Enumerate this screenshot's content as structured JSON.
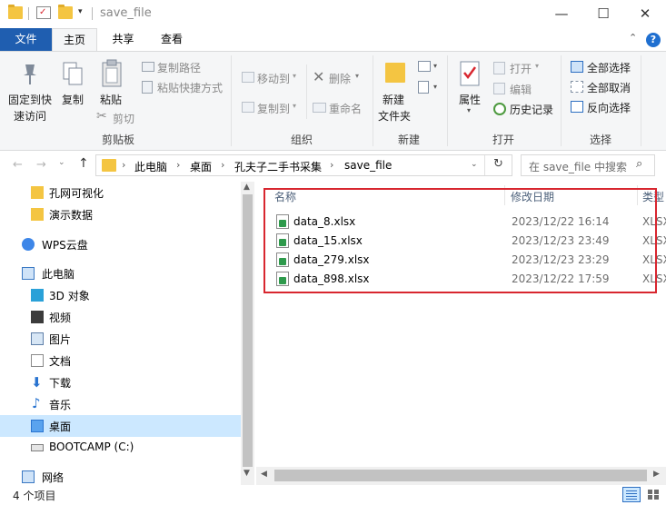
{
  "window": {
    "title": "save_file",
    "minimize": "—",
    "maximize": "☐",
    "close": "✕"
  },
  "tabs": {
    "file": "文件",
    "home": "主页",
    "share": "共享",
    "view": "查看"
  },
  "ribbon": {
    "clipboard": {
      "group": "剪贴板",
      "pin": "固定到快\n速访问",
      "pin_line1": "固定到快",
      "pin_line2": "速访问",
      "copy": "复制",
      "paste": "粘贴",
      "copy_path": "复制路径",
      "paste_shortcut": "粘贴快捷方式",
      "cut": "剪切"
    },
    "organize": {
      "group": "组织",
      "move_to": "移动到",
      "copy_to": "复制到",
      "delete": "删除",
      "rename": "重命名"
    },
    "new": {
      "group": "新建",
      "new_folder_line1": "新建",
      "new_folder_line2": "文件夹"
    },
    "open": {
      "group": "打开",
      "properties": "属性",
      "open": "打开",
      "edit": "编辑",
      "history": "历史记录"
    },
    "select": {
      "group": "选择",
      "select_all": "全部选择",
      "select_none": "全部取消",
      "invert": "反向选择"
    }
  },
  "address": {
    "crumbs": [
      "此电脑",
      "桌面",
      "孔夫子二手书采集",
      "save_file"
    ],
    "search_placeholder": "在 save_file 中搜索"
  },
  "nav": {
    "items": [
      {
        "label": "孔网可视化",
        "icon": "folder-icon"
      },
      {
        "label": "演示数据",
        "icon": "folder-icon"
      },
      {
        "label": "WPS云盘",
        "icon": "cloud-icon"
      },
      {
        "label": "此电脑",
        "icon": "computer-icon"
      },
      {
        "label": "3D 对象",
        "icon": "cube-icon"
      },
      {
        "label": "视频",
        "icon": "video-icon"
      },
      {
        "label": "图片",
        "icon": "picture-icon"
      },
      {
        "label": "文档",
        "icon": "document-icon"
      },
      {
        "label": "下载",
        "icon": "download-icon"
      },
      {
        "label": "音乐",
        "icon": "music-icon"
      },
      {
        "label": "桌面",
        "icon": "desktop-icon"
      },
      {
        "label": "BOOTCAMP (C:)",
        "icon": "drive-icon"
      },
      {
        "label": "网络",
        "icon": "network-icon"
      }
    ]
  },
  "filelist": {
    "columns": {
      "name": "名称",
      "date": "修改日期",
      "type": "类型"
    },
    "rows": [
      {
        "name": "data_8.xlsx",
        "date": "2023/12/22 16:14",
        "type": "XLSX"
      },
      {
        "name": "data_15.xlsx",
        "date": "2023/12/23 23:49",
        "type": "XLSX"
      },
      {
        "name": "data_279.xlsx",
        "date": "2023/12/23 23:29",
        "type": "XLSX"
      },
      {
        "name": "data_898.xlsx",
        "date": "2023/12/22 17:59",
        "type": "XLSX"
      }
    ]
  },
  "status": {
    "count": "4 个项目"
  },
  "colors": {
    "accent": "#1f5eb0",
    "highlight": "#d8262f",
    "selected": "#cce8ff"
  }
}
